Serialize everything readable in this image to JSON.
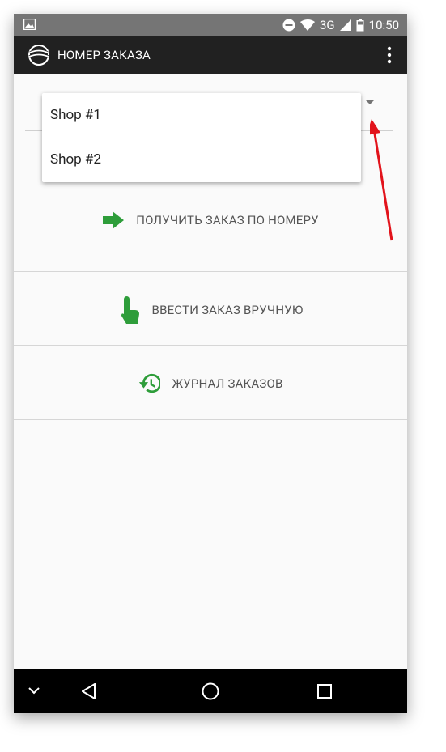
{
  "statusbar": {
    "network": "3G",
    "time": "10:50"
  },
  "appbar": {
    "title": "НОМЕР ЗАКАЗА"
  },
  "spinner": {
    "options": [
      "Shop #1",
      "Shop #2"
    ]
  },
  "actions": {
    "get_by_number": "ПОЛУЧИТЬ ЗАКАЗ ПО НОМЕРУ",
    "manual_entry": "ВВЕСТИ ЗАКАЗ ВРУЧНУЮ",
    "order_journal": "ЖУРНАЛ ЗАКАЗОВ"
  },
  "colors": {
    "accent_green": "#2e9d3a",
    "appbar": "#212121",
    "statusbar": "#757575",
    "annotation_arrow": "#e2131b"
  },
  "icons": {
    "status_left": "image-icon",
    "dnd": "do-not-disturb-icon",
    "wifi": "wifi-icon",
    "signal": "cell-signal-icon",
    "battery": "battery-icon",
    "logo": "app-logo-icon",
    "overflow": "more-vert-icon",
    "spinner": "dropdown-arrow-icon",
    "get_by_number": "arrow-right-icon",
    "manual_entry": "touch-hand-icon",
    "order_journal": "history-icon",
    "nav_collapse": "chevron-down-icon",
    "nav_back": "back-triangle-icon",
    "nav_home": "home-circle-icon",
    "nav_recents": "recents-square-icon"
  }
}
